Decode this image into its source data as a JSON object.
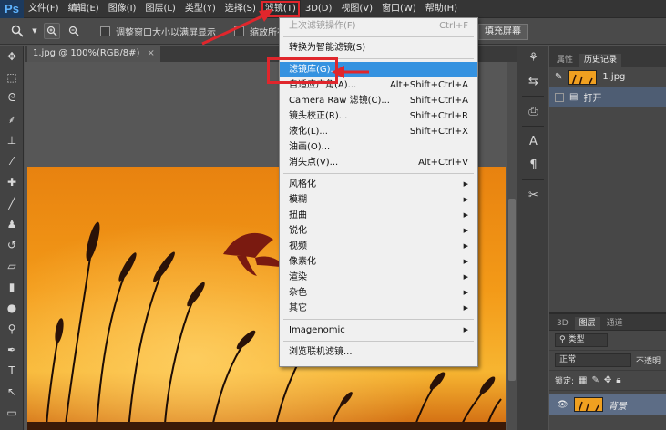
{
  "app_logo": "Ps",
  "menubar": {
    "items": [
      "文件(F)",
      "编辑(E)",
      "图像(I)",
      "图层(L)",
      "类型(Y)",
      "选择(S)",
      "滤镜(T)",
      "3D(D)",
      "视图(V)",
      "窗口(W)",
      "帮助(H)"
    ]
  },
  "options": {
    "resize_windows_label": "调整窗口大小以满屏显示",
    "zoom_all_label": "缩放所有",
    "fill_screen_button": "填充屏幕"
  },
  "document": {
    "tab_label": "1.jpg @ 100%(RGB/8#)",
    "close_glyph": "×"
  },
  "filter_menu": {
    "items": [
      {
        "label": "上次滤镜操作(F)",
        "shortcut": "Ctrl+F",
        "disabled": true,
        "submenu": false,
        "active": false
      },
      {
        "sep": true
      },
      {
        "label": "转换为智能滤镜(S)",
        "shortcut": "",
        "disabled": false,
        "submenu": false,
        "active": false
      },
      {
        "sep": true
      },
      {
        "label": "滤镜库(G)...",
        "shortcut": "",
        "disabled": false,
        "submenu": false,
        "active": true
      },
      {
        "label": "自适应广角(A)...",
        "shortcut": "Alt+Shift+Ctrl+A",
        "disabled": false,
        "submenu": false,
        "active": false
      },
      {
        "label": "Camera Raw 滤镜(C)...",
        "shortcut": "Shift+Ctrl+A",
        "disabled": false,
        "submenu": false,
        "active": false
      },
      {
        "label": "镜头校正(R)...",
        "shortcut": "Shift+Ctrl+R",
        "disabled": false,
        "submenu": false,
        "active": false
      },
      {
        "label": "液化(L)...",
        "shortcut": "Shift+Ctrl+X",
        "disabled": false,
        "submenu": false,
        "active": false
      },
      {
        "label": "油画(O)...",
        "shortcut": "",
        "disabled": false,
        "submenu": false,
        "active": false
      },
      {
        "label": "消失点(V)...",
        "shortcut": "Alt+Ctrl+V",
        "disabled": false,
        "submenu": false,
        "active": false
      },
      {
        "sep": true
      },
      {
        "label": "风格化",
        "shortcut": "",
        "disabled": false,
        "submenu": true,
        "active": false
      },
      {
        "label": "模糊",
        "shortcut": "",
        "disabled": false,
        "submenu": true,
        "active": false
      },
      {
        "label": "扭曲",
        "shortcut": "",
        "disabled": false,
        "submenu": true,
        "active": false
      },
      {
        "label": "锐化",
        "shortcut": "",
        "disabled": false,
        "submenu": true,
        "active": false
      },
      {
        "label": "视频",
        "shortcut": "",
        "disabled": false,
        "submenu": true,
        "active": false
      },
      {
        "label": "像素化",
        "shortcut": "",
        "disabled": false,
        "submenu": true,
        "active": false
      },
      {
        "label": "渲染",
        "shortcut": "",
        "disabled": false,
        "submenu": true,
        "active": false
      },
      {
        "label": "杂色",
        "shortcut": "",
        "disabled": false,
        "submenu": true,
        "active": false
      },
      {
        "label": "其它",
        "shortcut": "",
        "disabled": false,
        "submenu": true,
        "active": false
      },
      {
        "sep": true
      },
      {
        "label": "Imagenomic",
        "shortcut": "",
        "disabled": false,
        "submenu": true,
        "active": false
      },
      {
        "sep": true
      },
      {
        "label": "浏览联机滤镜...",
        "shortcut": "",
        "disabled": false,
        "submenu": false,
        "active": false
      }
    ]
  },
  "history_panel": {
    "tabs": [
      "属性",
      "历史记录"
    ],
    "snapshot_name": "1.jpg",
    "steps": [
      "打开"
    ]
  },
  "layers_panel": {
    "tabs": [
      "3D",
      "图层",
      "通道"
    ],
    "filter_label": "类型",
    "blend_mode": "正常",
    "opacity_label": "不透明",
    "lock_label": "锁定:",
    "layer_name": "背景"
  },
  "colors": {
    "accent": "#3592e0",
    "highlight_red": "#e0262c"
  }
}
